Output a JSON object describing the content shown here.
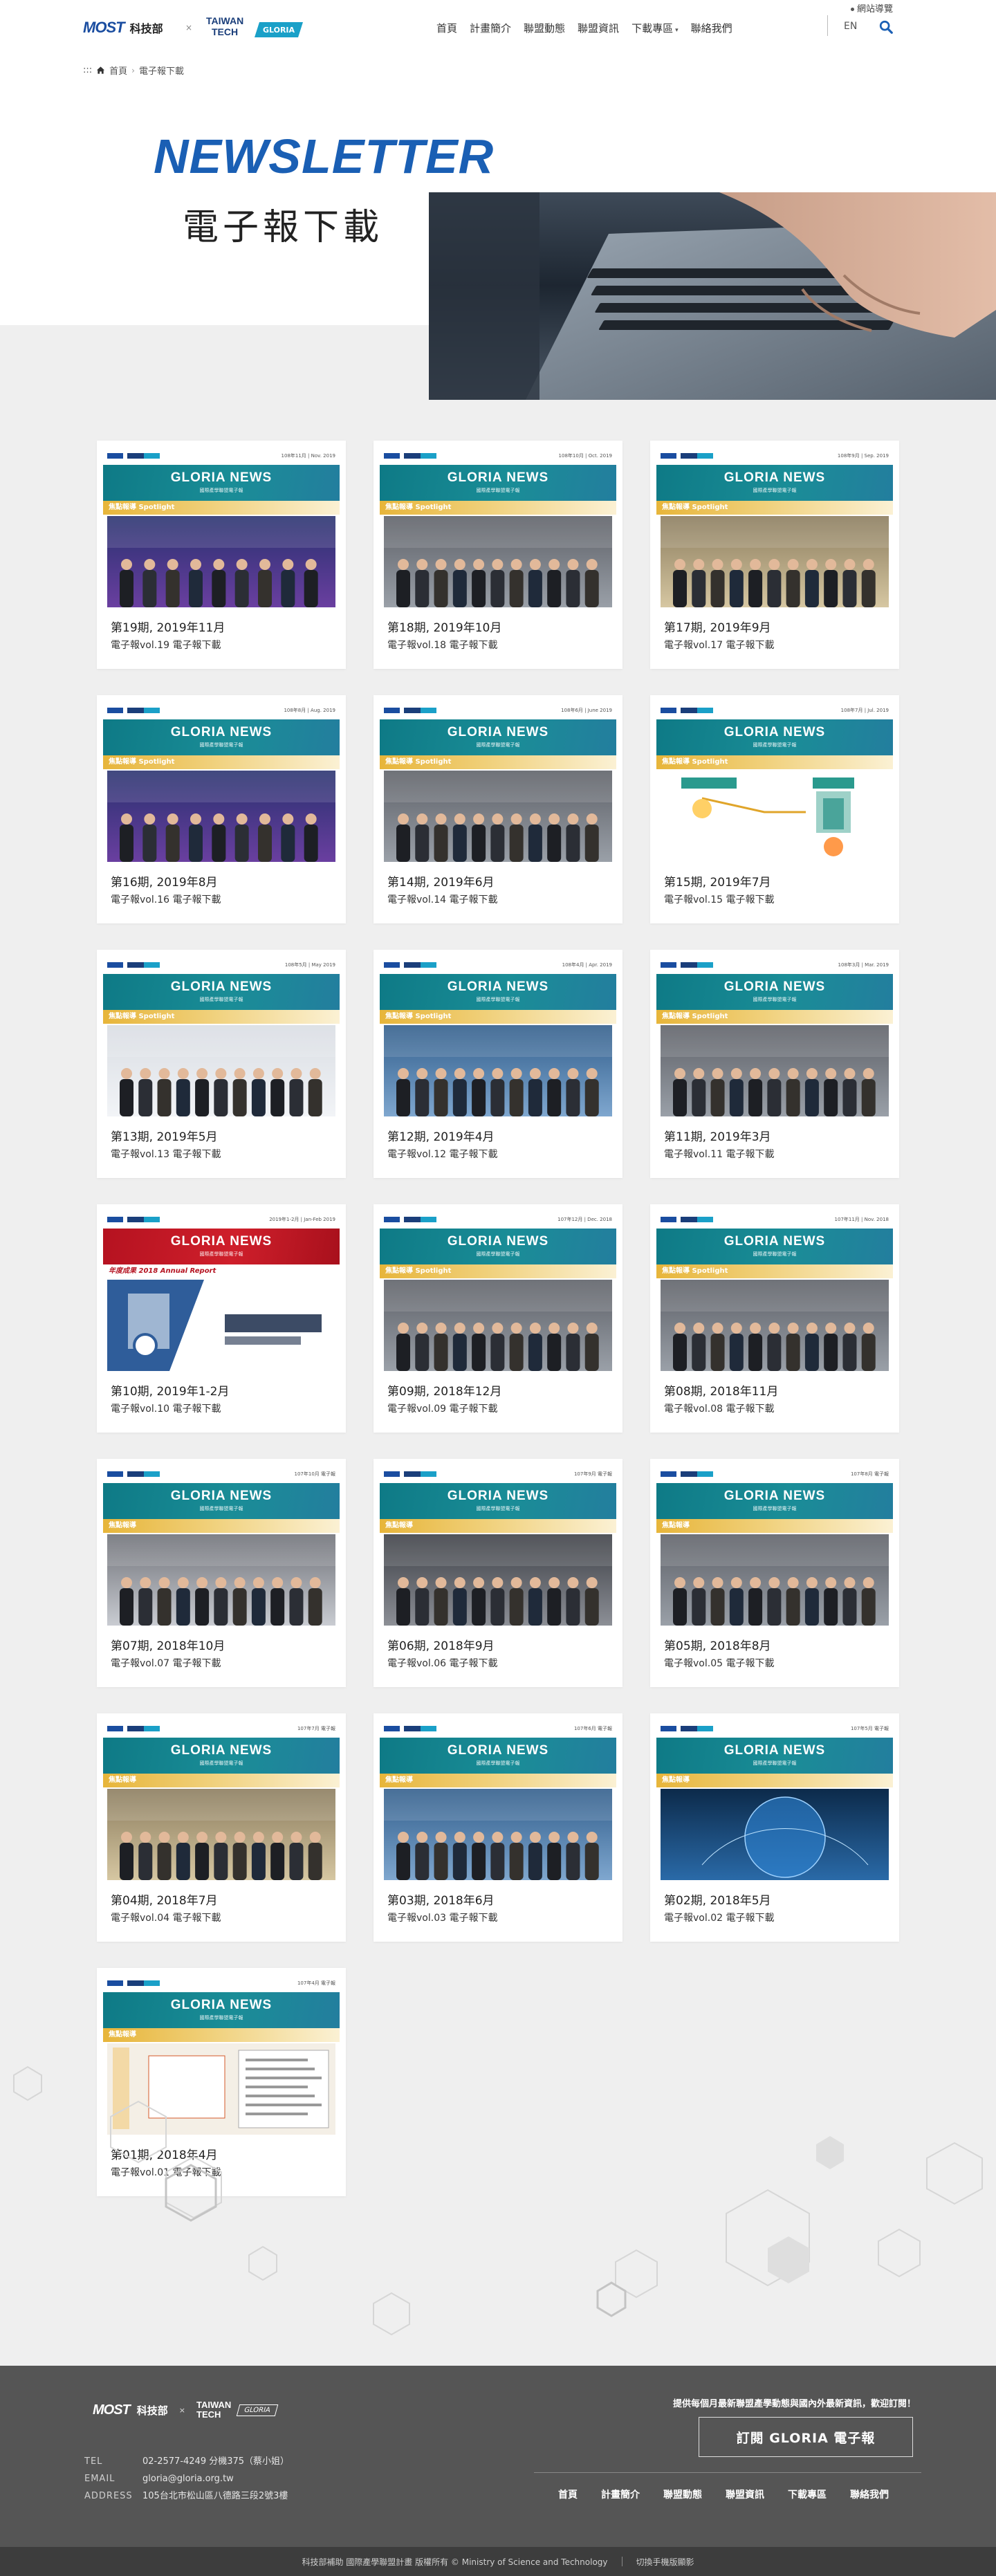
{
  "header": {
    "logo_most_text": "MOST",
    "logo_most_cn": "科技部",
    "logo_most_sub": "Ministry of Science and Technology",
    "logo_x": "×",
    "logo_taiwan": "TAIWAN",
    "logo_tech": "TECH",
    "logo_gloria": "GLORIA",
    "nav": [
      {
        "label": "首頁",
        "has_caret": false
      },
      {
        "label": "計畫簡介",
        "has_caret": false
      },
      {
        "label": "聯盟動態",
        "has_caret": false
      },
      {
        "label": "聯盟資訊",
        "has_caret": false
      },
      {
        "label": "下載專區",
        "has_caret": true
      },
      {
        "label": "聯絡我們",
        "has_caret": false
      }
    ],
    "sitemap_label": "網站導覽",
    "lang_label": "EN",
    "search_icon": "search-icon"
  },
  "breadcrumb": {
    "prefix": ":::",
    "home": "首頁",
    "current": "電子報下載"
  },
  "banner": {
    "title_en": "NEWSLETTER",
    "title_cn": "電子報下載"
  },
  "newsletter_band": {
    "title": "GLORIA NEWS",
    "subtitle": "國際產學聯盟電子報",
    "spotlight": "焦點報導 Spotlight",
    "spotlight_short": "焦點報導",
    "annual": "年度成果 2018 Annual Report"
  },
  "cards": [
    {
      "title": "第19期, 2019年11月",
      "sub": "電子報vol.19 電子報下載",
      "date": "108年11月 | Nov. 2019",
      "photo": "stage"
    },
    {
      "title": "第18期, 2019年10月",
      "sub": "電子報vol.18 電子報下載",
      "date": "108年10月 | Oct. 2019",
      "photo": "group"
    },
    {
      "title": "第17期, 2019年9月",
      "sub": "電子報vol.17 電子報下載",
      "date": "108年9月 | Sep. 2019",
      "photo": "ceremony"
    },
    {
      "title": "第16期, 2019年8月",
      "sub": "電子報vol.16 電子報下載",
      "date": "108年8月 | Aug. 2019",
      "photo": "stage"
    },
    {
      "title": "第14期, 2019年6月",
      "sub": "電子報vol.14 電子報下載",
      "date": "108年6月 | June 2019",
      "photo": "group"
    },
    {
      "title": "第15期, 2019年7月",
      "sub": "電子報vol.15 電子報下載",
      "date": "108年7月 | Jul. 2019",
      "photo": "diagram"
    },
    {
      "title": "第13期, 2019年5月",
      "sub": "電子報vol.13 電子報下載",
      "date": "108年5月 | May 2019",
      "photo": "expo"
    },
    {
      "title": "第12期, 2019年4月",
      "sub": "電子報vol.12 電子報下載",
      "date": "108年4月 | Apr. 2019",
      "photo": "booth"
    },
    {
      "title": "第11期, 2019年3月",
      "sub": "電子報vol.11 電子報下載",
      "date": "108年3月 | Mar. 2019",
      "photo": "group"
    },
    {
      "title": "第10期, 2019年1-2月",
      "sub": "電子報vol.10 電子報下載",
      "date": "2019年1-2月 | Jan-Feb 2019",
      "photo": "report",
      "red": true
    },
    {
      "title": "第09期, 2018年12月",
      "sub": "電子報vol.09 電子報下載",
      "date": "107年12月 | Dec. 2018",
      "photo": "group"
    },
    {
      "title": "第08期, 2018年11月",
      "sub": "電子報vol.08 電子報下載",
      "date": "107年11月 | Nov. 2018",
      "photo": "group"
    },
    {
      "title": "第07期, 2018年10月",
      "sub": "電子報vol.07 電子報下載",
      "date": "107年10月 電子報",
      "photo": "forum",
      "short": true
    },
    {
      "title": "第06期, 2018年9月",
      "sub": "電子報vol.06 電子報下載",
      "date": "107年9月 電子報",
      "photo": "meeting",
      "short": true
    },
    {
      "title": "第05期, 2018年8月",
      "sub": "電子報vol.05 電子報下載",
      "date": "107年8月 電子報",
      "photo": "group",
      "short": true
    },
    {
      "title": "第04期, 2018年7月",
      "sub": "電子報vol.04 電子報下載",
      "date": "107年7月 電子報",
      "photo": "ceremony",
      "short": true
    },
    {
      "title": "第03期, 2018年6月",
      "sub": "電子報vol.03 電子報下載",
      "date": "107年6月 電子報",
      "photo": "booth",
      "short": true
    },
    {
      "title": "第02期, 2018年5月",
      "sub": "電子報vol.02 電子報下載",
      "date": "107年5月 電子報",
      "photo": "globe",
      "short": true
    },
    {
      "title": "第01期, 2018年4月",
      "sub": "電子報vol.01 電子報下載",
      "date": "107年4月 電子報",
      "photo": "doc",
      "short": true
    }
  ],
  "footer": {
    "logo_most_text": "MOST",
    "logo_most_cn": "科技部",
    "logo_x": "×",
    "logo_taiwan": "TAIWAN",
    "logo_tech": "TECH",
    "logo_gloria": "GLORIA",
    "contact": [
      {
        "key": "TEL",
        "value": "02-2577-4249 分機375（蔡小姐）"
      },
      {
        "key": "EMAIL",
        "value": "gloria@gloria.org.tw"
      },
      {
        "key": "ADDRESS",
        "value": "105台北市松山區八德路三段2號3樓"
      }
    ],
    "promo": "提供每個月最新聯盟產學動態與國內外最新資訊，歡迎訂閱！",
    "subscribe_label": "訂閱 GLORIA 電子報",
    "nav": [
      "首頁",
      "計畫簡介",
      "聯盟動態",
      "聯盟資訊",
      "下載專區",
      "聯絡我們"
    ],
    "copyright": "科技部補助 國際產學聯盟計畫 版權所有 © Ministry of Science and Technology",
    "mobile_link": "切換手機版顯影"
  },
  "colors": {
    "accent_blue": "#1a5fb4",
    "teal_band": "#0e7a86",
    "spotlight_gold": "#e7b53a",
    "footer_bg": "#555555"
  }
}
